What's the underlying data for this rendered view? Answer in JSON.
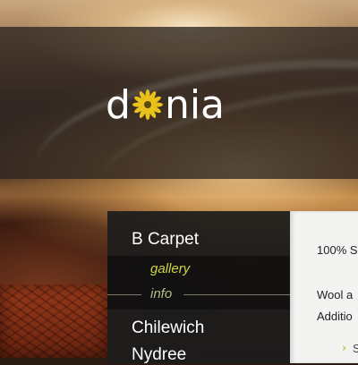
{
  "brand": {
    "logo_left": "d",
    "logo_right": "nia",
    "flower_color": "#e8c21a"
  },
  "menu": {
    "items": [
      {
        "label": "B Carpet"
      },
      {
        "label": "Chilewich"
      },
      {
        "label": "Nydree"
      }
    ],
    "submenu": [
      {
        "label": "gallery"
      },
      {
        "label": "info"
      }
    ]
  },
  "content": {
    "lines": [
      "100% S",
      "Wool a",
      "Additio"
    ],
    "more_icon": "chevron-right-icon",
    "more_text": "S"
  },
  "colors": {
    "accent_yellow": "#cfd73f",
    "menu_bg": "#1c1c1c",
    "content_bg": "#f3f3f1"
  }
}
